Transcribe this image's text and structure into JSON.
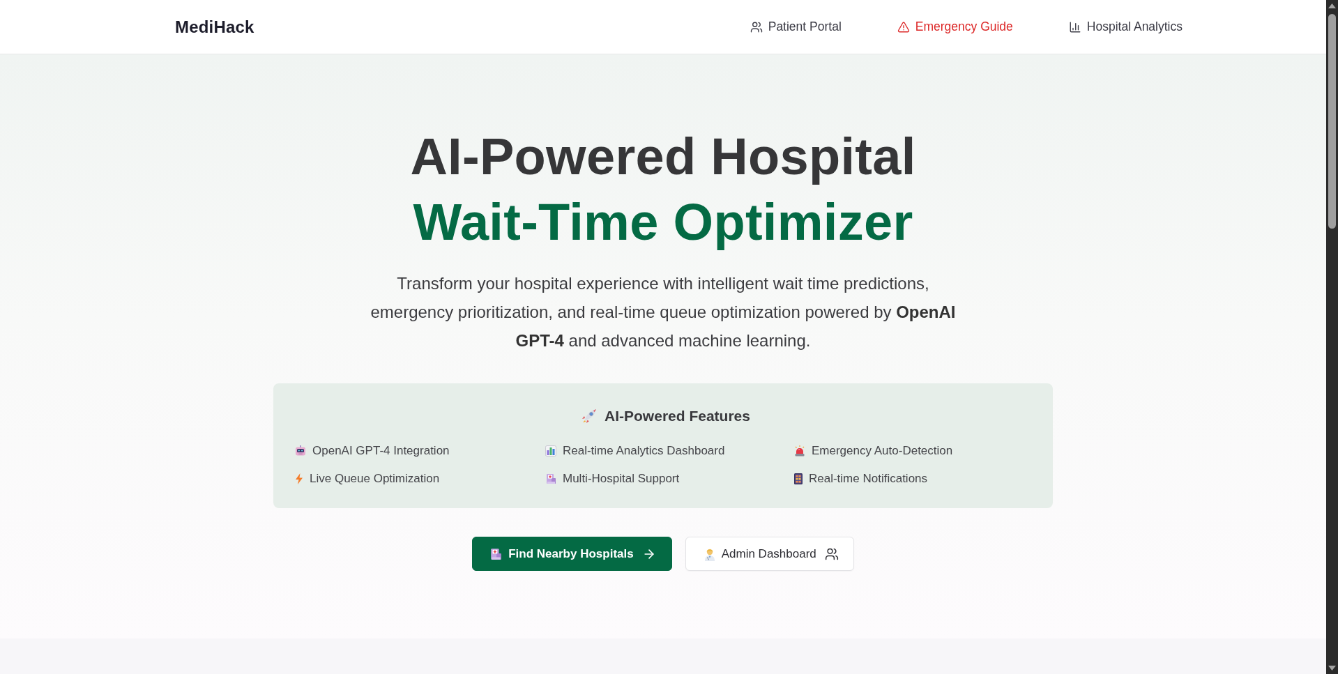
{
  "header": {
    "logo": "MediHack",
    "nav": [
      {
        "label": "Patient Portal",
        "kind": "people"
      },
      {
        "label": "Emergency Guide",
        "kind": "alert"
      },
      {
        "label": "Hospital Analytics",
        "kind": "chart"
      }
    ]
  },
  "hero": {
    "title": "AI-Powered Hospital",
    "title_highlight": "Wait-Time Optimizer",
    "description": "Transform your hospital experience with intelligent wait time predictions, emergency prioritization, and real-time queue optimization powered by **OpenAI GPT-4** and advanced machine learning.",
    "features": {
      "title": "AI-Powered Features",
      "items": [
        "OpenAI GPT-4 Integration",
        "Real-time Analytics Dashboard",
        "Emergency Auto-Detection",
        "Live Queue Optimization",
        "Multi-Hospital Support",
        "Real-time Notifications"
      ]
    },
    "buttons": [
      {
        "label": "Find Nearby Hospitals",
        "kind": "primary"
      },
      {
        "label": "Admin Dashboard",
        "kind": "outline"
      }
    ]
  }
}
